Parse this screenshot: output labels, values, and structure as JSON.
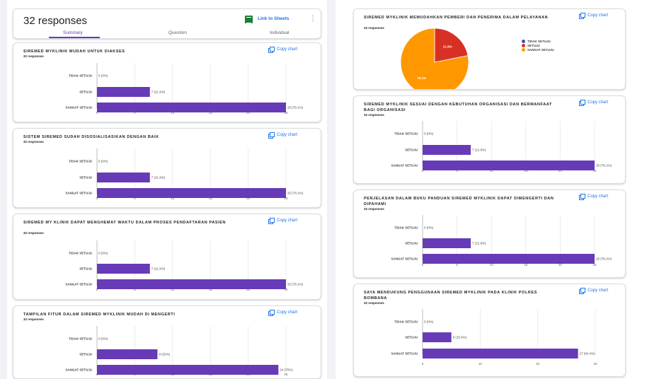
{
  "summary": {
    "responses_title": "32 responses",
    "sheets_link": "Link to Sheets",
    "tabs": [
      "Summary",
      "Question",
      "Individual"
    ],
    "active_tab": 0
  },
  "copy_chart_label": "Copy chart",
  "colors": {
    "bar": "#673ab7",
    "pie_red": "#d93025",
    "pie_orange": "#ff9800",
    "pie_blue": "#3f51b5",
    "link": "#1a73e8"
  },
  "questions": [
    {
      "title": "SIREMED MYKLINIK MUDAH UNTUK DIAKSES",
      "count": "32 responses",
      "chart_data": {
        "type": "bar",
        "categories": [
          "TIDAK SETUJU",
          "SETUJU",
          "SANGAT SETUJU"
        ],
        "values": [
          0,
          7,
          25
        ],
        "data_labels": [
          "0 (0%)",
          "7 (21.9%)",
          "25 (78.1%)"
        ],
        "xticks": [
          "0",
          "5",
          "10",
          "15",
          "20",
          "25"
        ],
        "xlim": [
          0,
          25
        ]
      }
    },
    {
      "title": "SISTEM SIREMED SUDAH DISOSIALISASIKAN DENGAN BAIK",
      "count": "32 responses",
      "chart_data": {
        "type": "bar",
        "categories": [
          "TIDAK SETUJU",
          "SETUJU",
          "SANGAT SETUJU"
        ],
        "values": [
          0,
          7,
          25
        ],
        "data_labels": [
          "0 (0%)",
          "7 (21.9%)",
          "25 (78.1%)"
        ],
        "xticks": [
          "0",
          "5",
          "10",
          "15",
          "20",
          "25"
        ],
        "xlim": [
          0,
          25
        ]
      }
    },
    {
      "title": "SIREMED MY KLINIK DAPAT MENGHEMAT WAKTU DALAM PROSES PENDAFTARAN PASIEN",
      "count": "32 responses",
      "chart_data": {
        "type": "bar",
        "categories": [
          "TIDAK SETUJU",
          "SETUJU",
          "SANGAT SETUJU"
        ],
        "values": [
          0,
          7,
          25
        ],
        "data_labels": [
          "0 (0%)",
          "7 (21.9%)",
          "25 (78.1%)"
        ],
        "xticks": [
          "0",
          "5",
          "10",
          "15",
          "20",
          "25"
        ],
        "xlim": [
          0,
          25
        ]
      }
    },
    {
      "title": "TAMPILAN FITUR DALAM SIREMED MYKLINIK MUDAH DI MENGERTI",
      "count": "32 responses",
      "chart_data": {
        "type": "bar",
        "categories": [
          "TIDAK SETUJU",
          "SETUJU",
          "SANGAT SETUJU"
        ],
        "values": [
          0,
          8,
          24
        ],
        "data_labels": [
          "0 (0%)",
          "8 (25%)",
          "24 (75%)"
        ],
        "xticks": [
          "0",
          "5",
          "10",
          "15",
          "20",
          "25"
        ],
        "xlim": [
          0,
          25
        ]
      }
    },
    {
      "title": "SIREMED MYKLINIK MEMUDAHKAN PEMBERI DAN PENERIMA DALAM PELAYANAN",
      "count": "32 responses",
      "chart_data": {
        "type": "pie",
        "labels": [
          "TIDAK SETUJU",
          "SETUJU",
          "SANGAT SETUJU"
        ],
        "values": [
          0,
          7,
          25
        ],
        "slice_labels": [
          "",
          "21.9%",
          "78.1%"
        ]
      }
    },
    {
      "title": "SIREMED MYKLINIK SESUAI DENGAN KEBUTUHAN ORGANISASI DAN BERMANFAAT BAGI ORGANISASI",
      "count": "32 responses",
      "chart_data": {
        "type": "bar",
        "categories": [
          "TIDAK SETUJU",
          "SETUJU",
          "SANGAT SETUJU"
        ],
        "values": [
          0,
          7,
          25
        ],
        "data_labels": [
          "0 (0%)",
          "7 (21.9%)",
          "25 (78.1%)"
        ],
        "xticks": [
          "0",
          "5",
          "10",
          "15",
          "20",
          "25"
        ],
        "xlim": [
          0,
          25
        ]
      }
    },
    {
      "title": "PENJELASAN DALAM BUKU PANDUAN SIREMED MYKLINIK DAPAT DIMENGERTI DAN DIPAHAMI",
      "count": "32 responses",
      "chart_data": {
        "type": "bar",
        "categories": [
          "TIDAK SETUJU",
          "SETUJU",
          "SANGAT SETUJU"
        ],
        "values": [
          0,
          7,
          25
        ],
        "data_labels": [
          "0 (0%)",
          "7 (21.9%)",
          "25 (78.1%)"
        ],
        "xticks": [
          "0",
          "5",
          "10",
          "15",
          "20",
          "25"
        ],
        "xlim": [
          0,
          25
        ]
      }
    },
    {
      "title": "SAYA MENDUKUNG PENGGUNAAN SIREMED MYKLINIK PADA KLINIK POLRES BOMBANA",
      "count": "32 responses",
      "chart_data": {
        "type": "bar",
        "categories": [
          "TIDAK SETUJU",
          "SETUJU",
          "SANGAT SETUJU"
        ],
        "values": [
          0,
          5,
          27
        ],
        "data_labels": [
          "0 (0%)",
          "5 (15.6%)",
          "27 (84.4%)"
        ],
        "xticks": [
          "0",
          "10",
          "20",
          "30"
        ],
        "xlim": [
          0,
          30
        ]
      }
    }
  ]
}
